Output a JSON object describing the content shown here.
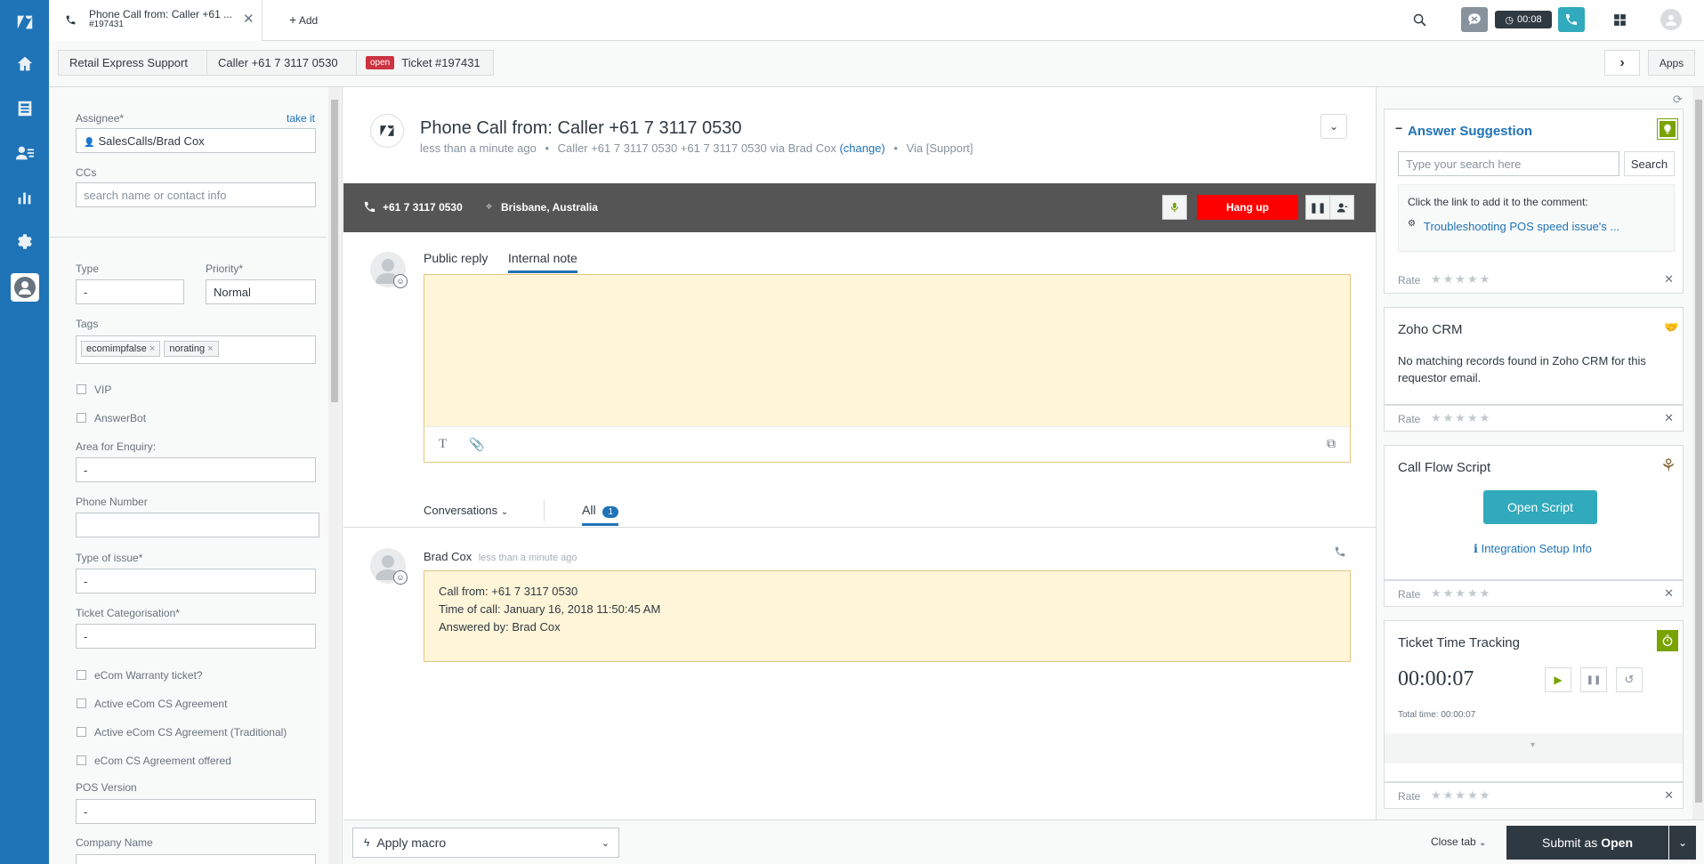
{
  "nav": {
    "items": [
      "logo",
      "home",
      "views",
      "customers",
      "reporting",
      "admin",
      "app"
    ]
  },
  "topbar": {
    "tab_title": "Phone Call from: Caller +61 ...",
    "tab_sub": "#197431",
    "add_label": "Add",
    "timer": "00:08"
  },
  "breadcrumb": {
    "org": "Retail Express Support",
    "caller": "Caller +61 7 3117 0530",
    "status": "open",
    "ticket": "Ticket #197431",
    "apps_label": "Apps"
  },
  "left": {
    "assignee_label": "Assignee*",
    "take_it": "take it",
    "assignee_value": "SalesCalls/Brad Cox",
    "ccs_label": "CCs",
    "ccs_placeholder": "search name or contact info",
    "type_label": "Type",
    "type_value": "-",
    "priority_label": "Priority*",
    "priority_value": "Normal",
    "tags_label": "Tags",
    "tags": [
      "ecomimpfalse",
      "norating"
    ],
    "vip_label": "VIP",
    "answerbot_label": "AnswerBot",
    "area_label": "Area for Enquiry:",
    "area_value": "-",
    "phone_label": "Phone Number",
    "phone_value": "",
    "issue_label": "Type of issue*",
    "issue_value": "-",
    "categ_label": "Ticket Categorisation*",
    "categ_value": "-",
    "ecom_warranty": "eCom Warranty ticket?",
    "active_ecom": "Active eCom CS Agreement",
    "active_ecom_trad": "Active eCom CS Agreement (Traditional)",
    "ecom_offered": "eCom CS Agreement offered",
    "pos_label": "POS Version",
    "pos_value": "-",
    "company_label": "Company Name"
  },
  "ticket": {
    "title": "Phone Call from: Caller +61 7 3117 0530",
    "meta_time": "less than a minute ago",
    "meta_caller": "Caller +61 7 3117 0530 +61 7 3117 0530 via Brad Cox",
    "meta_change": "(change)",
    "meta_via": "Via [Support]"
  },
  "call": {
    "number": "+61 7 3117 0530",
    "location": "Brisbane, Australia",
    "hangup": "Hang up"
  },
  "editor": {
    "public_reply": "Public reply",
    "internal_note": "Internal note"
  },
  "conversation": {
    "filter_label": "Conversations",
    "all_label": "All",
    "all_count": "1",
    "author": "Brad Cox",
    "time": "less than a minute ago",
    "line1": "Call from: +61 7 3117 0530",
    "line2": "Time of call: January 16, 2018 11:50:45 AM",
    "line3": "Answered by: Brad Cox"
  },
  "right": {
    "answer_title": "Answer Suggestion",
    "search_placeholder": "Type your search here",
    "search_btn": "Search",
    "click_hint": "Click the link to add it to the comment:",
    "suggestion_link": "Troubleshooting POS speed issue's ...",
    "rate_label": "Rate",
    "zoho_title": "Zoho CRM",
    "zoho_text": "No matching records found in Zoho CRM for this requestor email.",
    "callflow_title": "Call Flow Script",
    "open_script": "Open Script",
    "integration_info": "Integration Setup Info",
    "time_title": "Ticket Time Tracking",
    "timer_value": "00:00:07",
    "total_time_label": "Total time:",
    "total_time_value": "00:00:07"
  },
  "bottom": {
    "apply_macro": "Apply macro",
    "close_tab": "Close tab",
    "submit_as": "Submit as",
    "submit_status": "Open"
  },
  "colors": {
    "nav_blue": "#1f73b7",
    "hangup_red": "#ff0000",
    "open_badge": "#cc3340",
    "teal": "#30aabc",
    "note_yellow": "#fff5d9",
    "submit_dark": "#2f3941"
  }
}
